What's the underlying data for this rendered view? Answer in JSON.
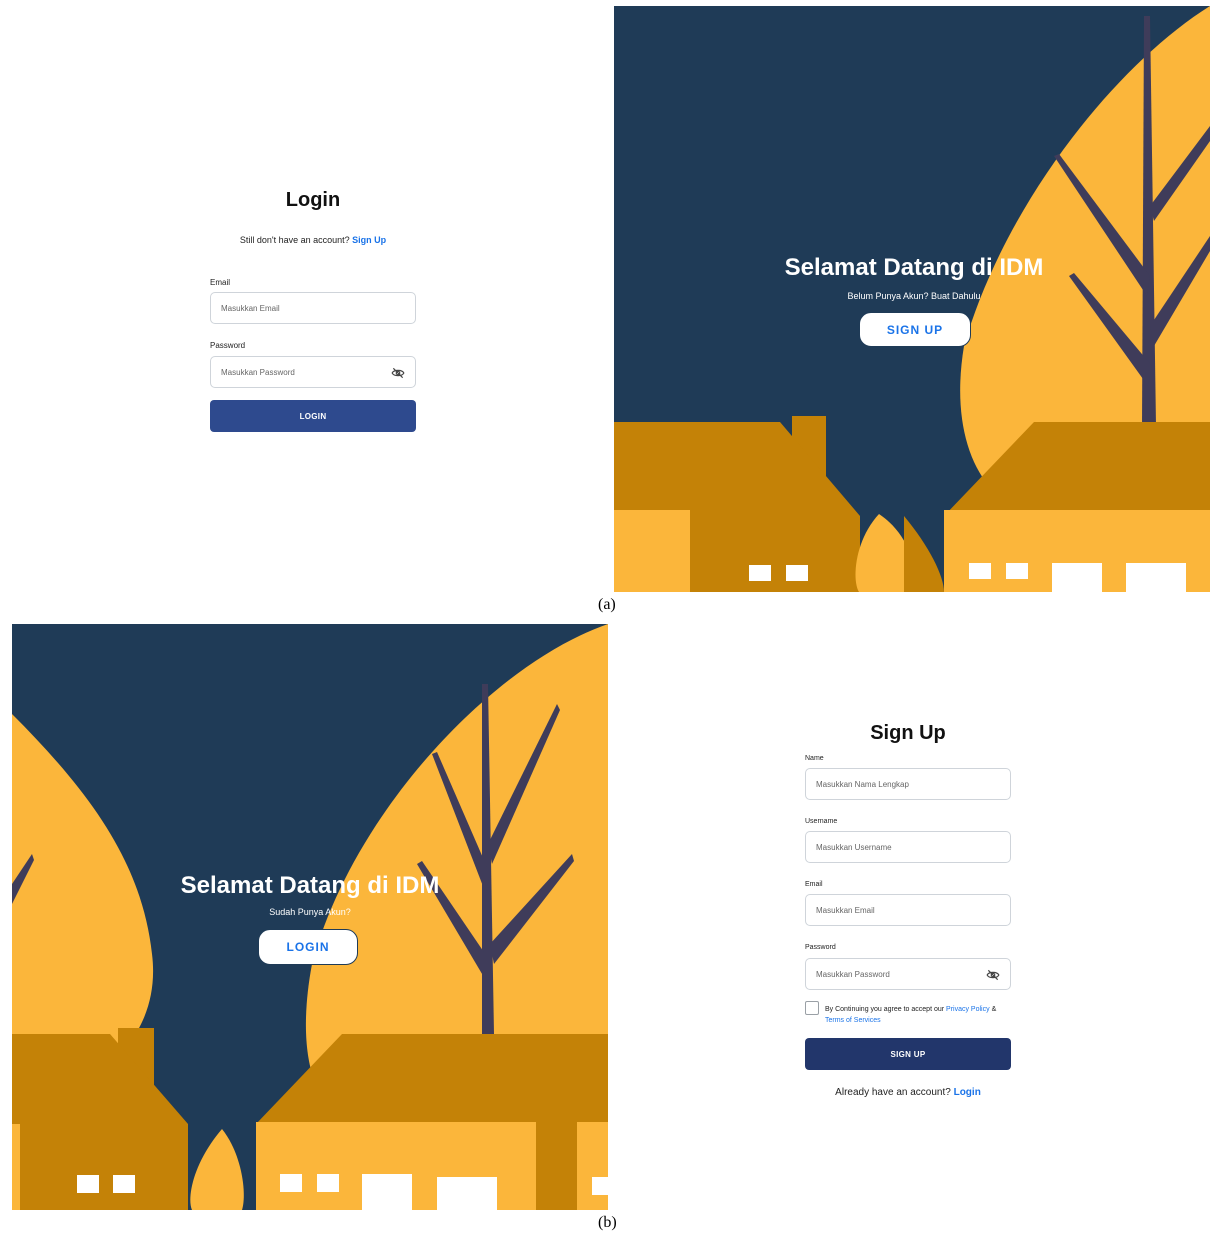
{
  "login_screen": {
    "title": "Login",
    "subtitle_text": "Still don't have an account?",
    "subtitle_link": "Sign Up",
    "email_label": "Email",
    "email_placeholder": "Masukkan Email",
    "password_label": "Password",
    "password_placeholder": "Masukkan Password",
    "submit_label": "LOGIN",
    "hero_title": "Selamat Datang di IDM",
    "hero_subtitle": "Belum Punya Akun? Buat Dahulu",
    "hero_button": "SIGN UP"
  },
  "signup_screen": {
    "hero_title": "Selamat Datang di IDM",
    "hero_subtitle": "Sudah Punya Akun?",
    "hero_button": "LOGIN",
    "title": "Sign Up",
    "name_label": "Name",
    "name_placeholder": "Masukkan Nama Lengkap",
    "username_label": "Username",
    "username_placeholder": "Masukkan Username",
    "email_label": "Email",
    "email_placeholder": "Masukkan Email",
    "password_label": "Password",
    "password_placeholder": "Masukkan Password",
    "terms_text": "By Continuing you agree to accept our",
    "terms_privacy": "Privacy Policy",
    "terms_and": "&",
    "terms_tos": "Terms of Services",
    "submit_label": "SIGN UP",
    "footer_text": "Already have an account?",
    "footer_link": "Login"
  },
  "captions": {
    "a": "(a)",
    "b": "(b)"
  },
  "icons": {
    "password_toggle": "eye-slash-icon"
  },
  "colors": {
    "navy_bg": "#1f3b57",
    "leaf_yellow": "#fbb63b",
    "house_dark": "#c48207",
    "branch": "#3f3c5a",
    "link_blue": "#1a73e8",
    "button_blue": "#2e4a8e"
  }
}
